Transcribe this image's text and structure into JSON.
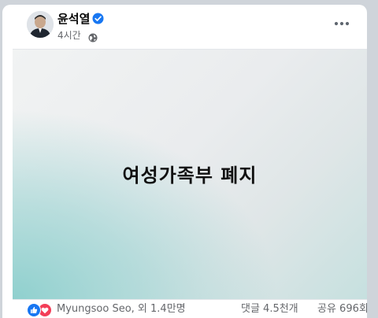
{
  "post": {
    "author": "윤석열",
    "time": "4시간",
    "verified_icon": "verified-badge-icon",
    "privacy_icon": "globe-icon",
    "more_icon": "more-options-icon",
    "image_text": "여성가족부 폐지"
  },
  "engagement": {
    "reaction_icons": [
      "like-icon",
      "love-icon"
    ],
    "reactors": "Myungsoo Seo, 외 1.4만명",
    "comments": "댓글 4.5천개",
    "shares": "공유 696회"
  },
  "colors": {
    "accent": "#1877f2",
    "love": "#f33e58",
    "secondary_text": "#65676b",
    "teal": "#8fd0ce"
  }
}
